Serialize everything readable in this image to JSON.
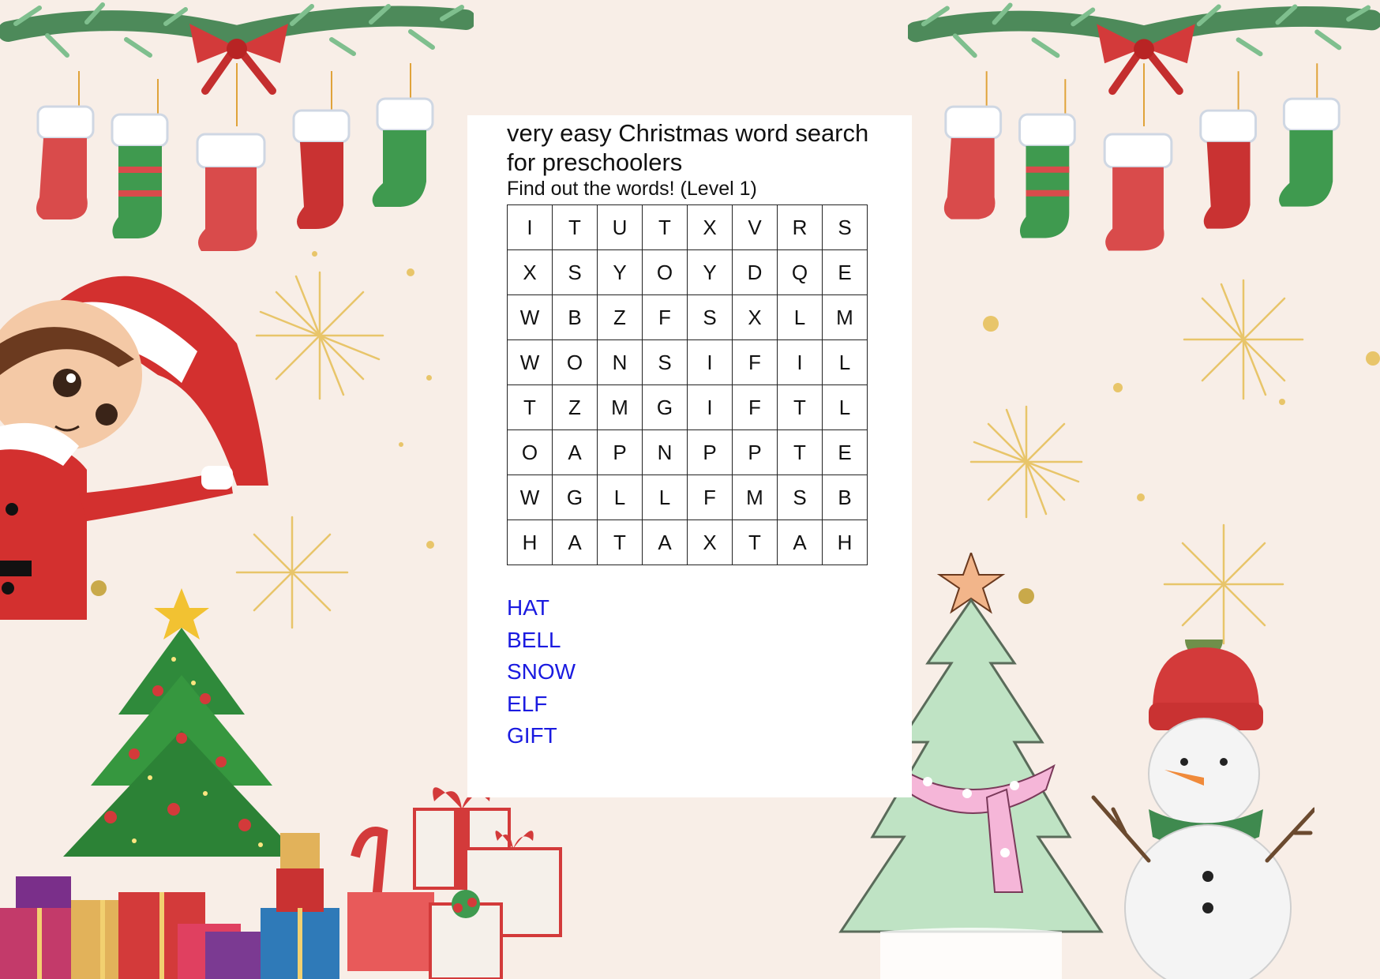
{
  "worksheet": {
    "title": "very easy Christmas word search for preschoolers",
    "subtitle": "Find out the words! (Level 1)",
    "grid": [
      [
        "I",
        "T",
        "U",
        "T",
        "X",
        "V",
        "R",
        "S"
      ],
      [
        "X",
        "S",
        "Y",
        "O",
        "Y",
        "D",
        "Q",
        "E"
      ],
      [
        "W",
        "B",
        "Z",
        "F",
        "S",
        "X",
        "L",
        "M"
      ],
      [
        "W",
        "O",
        "N",
        "S",
        "I",
        "F",
        "I",
        "L"
      ],
      [
        "T",
        "Z",
        "M",
        "G",
        "I",
        "F",
        "T",
        "L"
      ],
      [
        "O",
        "A",
        "P",
        "N",
        "P",
        "P",
        "T",
        "E"
      ],
      [
        "W",
        "G",
        "L",
        "L",
        "F",
        "M",
        "S",
        "B"
      ],
      [
        "H",
        "A",
        "T",
        "A",
        "X",
        "T",
        "A",
        "H"
      ]
    ],
    "words": [
      "HAT",
      "BELL",
      "SNOW",
      "ELF",
      "GIFT"
    ],
    "word_color": "#1a1ae0"
  },
  "decorations": {
    "background_color": "#f8eee7",
    "items": [
      "garland-with-stockings",
      "elf",
      "christmas-tree",
      "gift-boxes",
      "pastel-christmas-tree",
      "snowman",
      "gold-sparkles"
    ]
  }
}
